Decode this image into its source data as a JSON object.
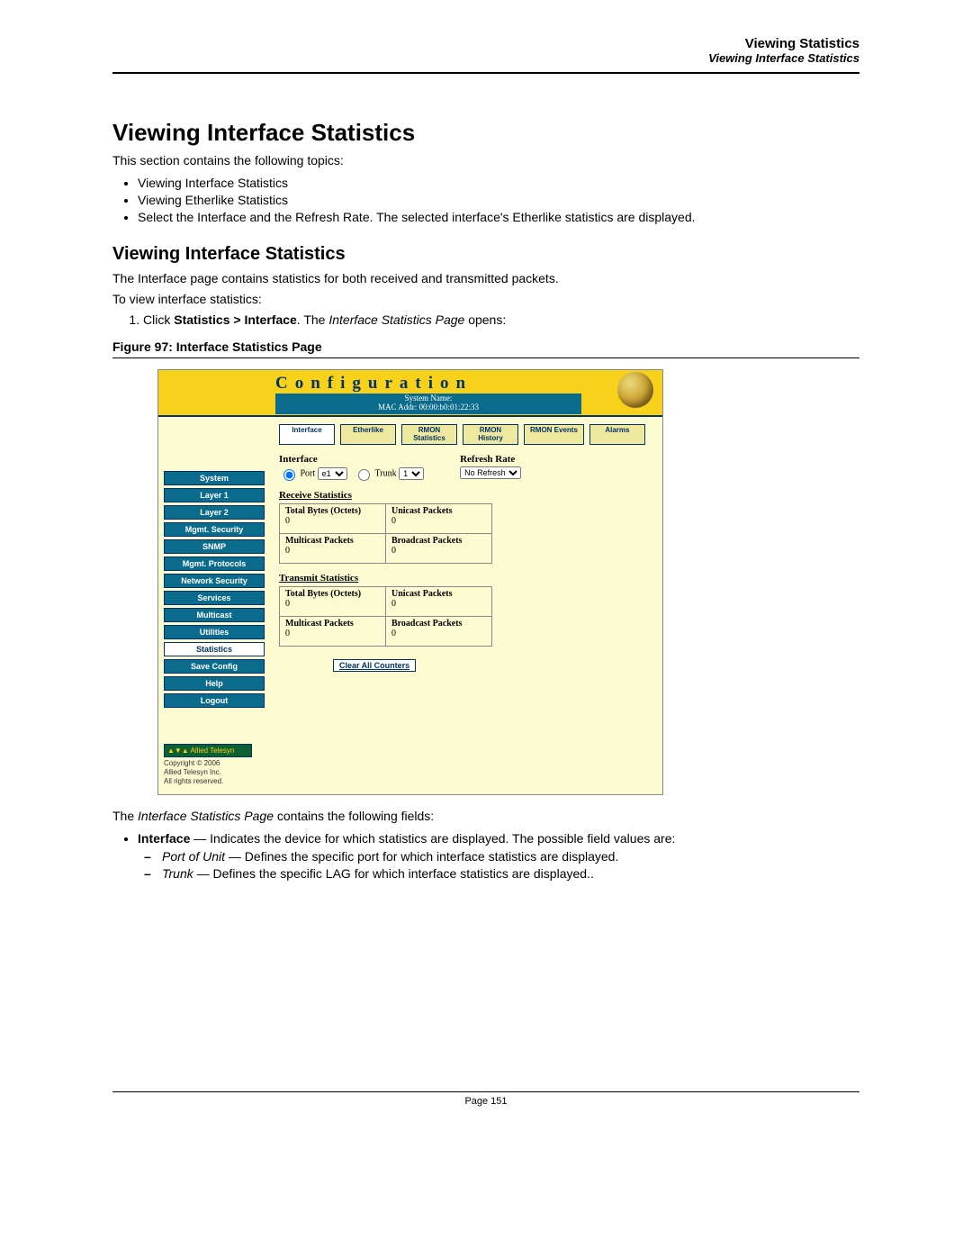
{
  "header": {
    "title": "Viewing Statistics",
    "subtitle": "Viewing Interface Statistics"
  },
  "h1": "Viewing Interface Statistics",
  "intro": "This section contains the following topics:",
  "topics": [
    "Viewing Interface Statistics",
    "Viewing Etherlike Statistics",
    "Select the Interface and the Refresh Rate. The selected interface's Etherlike statistics are displayed."
  ],
  "h2": "Viewing Interface Statistics",
  "para1": "The Interface page contains statistics for both received and transmitted packets.",
  "para2": "To view interface statistics:",
  "step1_a": "Click ",
  "step1_b": "Statistics > Interface",
  "step1_c": ". The ",
  "step1_d": "Interface Statistics Page",
  "step1_e": " opens:",
  "figcap": "Figure 97:  Interface Statistics Page",
  "ui": {
    "conf_title": "Configuration",
    "sysname_lbl": "System Name:",
    "mac_lbl": "MAC Addr: 00:00:b0:01:22:33",
    "sidebar": [
      "System",
      "Layer 1",
      "Layer 2",
      "Mgmt. Security",
      "SNMP",
      "Mgmt. Protocols",
      "Network Security",
      "Services",
      "Multicast",
      "Utilities",
      "Statistics",
      "Save Config",
      "Help",
      "Logout"
    ],
    "sidebar_white_indices": [
      10
    ],
    "tabs": [
      {
        "l": "Interface",
        "active": true,
        "multi": false
      },
      {
        "l": "Etherlike",
        "active": false,
        "multi": false
      },
      {
        "l": "RMON Statistics",
        "active": false,
        "multi": true
      },
      {
        "l": "RMON History",
        "active": false,
        "multi": true
      },
      {
        "l": "RMON Events",
        "active": false,
        "multi": false
      },
      {
        "l": "Alarms",
        "active": false,
        "multi": false
      }
    ],
    "iface": {
      "title": "Interface",
      "port_lbl": "Port",
      "port_val": "e1",
      "trunk_lbl": "Trunk",
      "trunk_val": "1"
    },
    "refresh": {
      "title": "Refresh Rate",
      "val": "No Refresh"
    },
    "recv_title": "Receive Statistics",
    "xmit_title": "Transmit Statistics",
    "cells": {
      "tbo": "Total Bytes (Octets)",
      "up": "Unicast Packets",
      "mp": "Multicast Packets",
      "bp": "Broadcast Packets",
      "zero": "0"
    },
    "clear_btn": "Clear All Counters",
    "foot": {
      "brand": "Allied Telesyn",
      "l1": "Copyright © 2006",
      "l2": "Allied Telesyn Inc.",
      "l3": "All rights reserved."
    }
  },
  "after_fig": {
    "lead_a": "The ",
    "lead_b": "Interface Statistics Page",
    "lead_c": " contains the following fields:",
    "bul_lbl": "Interface",
    "bul_txt": " — Indicates the device for which statistics are displayed. The possible field values are:",
    "d1_lbl": "Port of Unit",
    "d1_txt": " — Defines the specific port for which interface statistics are displayed.",
    "d2_lbl": "Trunk",
    "d2_txt": " — Defines the specific LAG for which interface statistics are displayed.."
  },
  "page_num": "Page 151"
}
